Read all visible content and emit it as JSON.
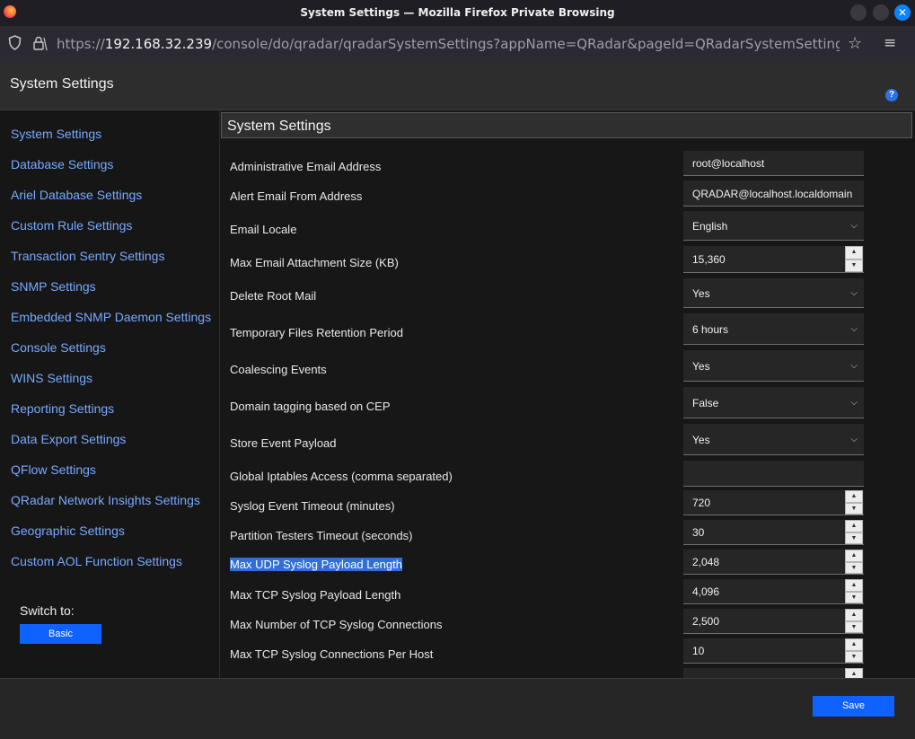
{
  "browser": {
    "window_title": "System Settings — Mozilla Firefox Private Browsing",
    "url_scheme": "https://",
    "url_host": "192.168.32.239",
    "url_rest": "/console/do/qradar/qradarSystemSettings?appName=QRadar&pageId=QRadarSystemSettings#sysSetting"
  },
  "header": {
    "title": "System Settings",
    "help": "?"
  },
  "sidebar": {
    "items": [
      {
        "label": "System Settings"
      },
      {
        "label": "Database Settings"
      },
      {
        "label": "Ariel Database Settings"
      },
      {
        "label": "Custom Rule Settings"
      },
      {
        "label": "Transaction Sentry Settings"
      },
      {
        "label": "SNMP Settings"
      },
      {
        "label": "Embedded SNMP Daemon Settings"
      },
      {
        "label": "Console Settings"
      },
      {
        "label": "WINS Settings"
      },
      {
        "label": "Reporting Settings"
      },
      {
        "label": "Data Export Settings"
      },
      {
        "label": "QFlow Settings"
      },
      {
        "label": "QRadar Network Insights Settings"
      },
      {
        "label": "Geographic Settings"
      },
      {
        "label": "Custom AOL Function Settings"
      }
    ],
    "switch_label": "Switch to:",
    "basic_button": "Basic"
  },
  "main": {
    "title": "System Settings",
    "rows": [
      {
        "label": "Administrative Email Address",
        "value": "root@localhost",
        "control": "text"
      },
      {
        "label": "Alert Email From Address",
        "value": "QRADAR@localhost.localdomain",
        "control": "text"
      },
      {
        "label": "Email Locale",
        "value": "English",
        "control": "select"
      },
      {
        "label": "Max Email Attachment Size (KB)",
        "value": "15,360",
        "control": "number"
      },
      {
        "label": "Delete Root Mail",
        "value": "Yes",
        "control": "select"
      },
      {
        "label": "Temporary Files Retention Period",
        "value": "6 hours",
        "control": "select"
      },
      {
        "label": "Coalescing Events",
        "value": "Yes",
        "control": "select"
      },
      {
        "label": "Domain tagging based on CEP",
        "value": "False",
        "control": "select"
      },
      {
        "label": "Store Event Payload",
        "value": "Yes",
        "control": "select"
      },
      {
        "label": "Global Iptables Access (comma separated)",
        "value": "",
        "control": "text"
      },
      {
        "label": "Syslog Event Timeout (minutes)",
        "value": "720",
        "control": "number"
      },
      {
        "label": "Partition Testers Timeout (seconds)",
        "value": "30",
        "control": "number"
      },
      {
        "label": "Max UDP Syslog Payload Length",
        "value": "2,048",
        "control": "number"
      },
      {
        "label": "Max TCP Syslog Payload Length",
        "value": "4,096",
        "control": "number"
      },
      {
        "label": "Max Number of TCP Syslog Connections",
        "value": "2,500",
        "control": "number"
      },
      {
        "label": "Max TCP Syslog Connections Per Host",
        "value": "10",
        "control": "number"
      }
    ]
  },
  "footer": {
    "save_button": "Save"
  }
}
